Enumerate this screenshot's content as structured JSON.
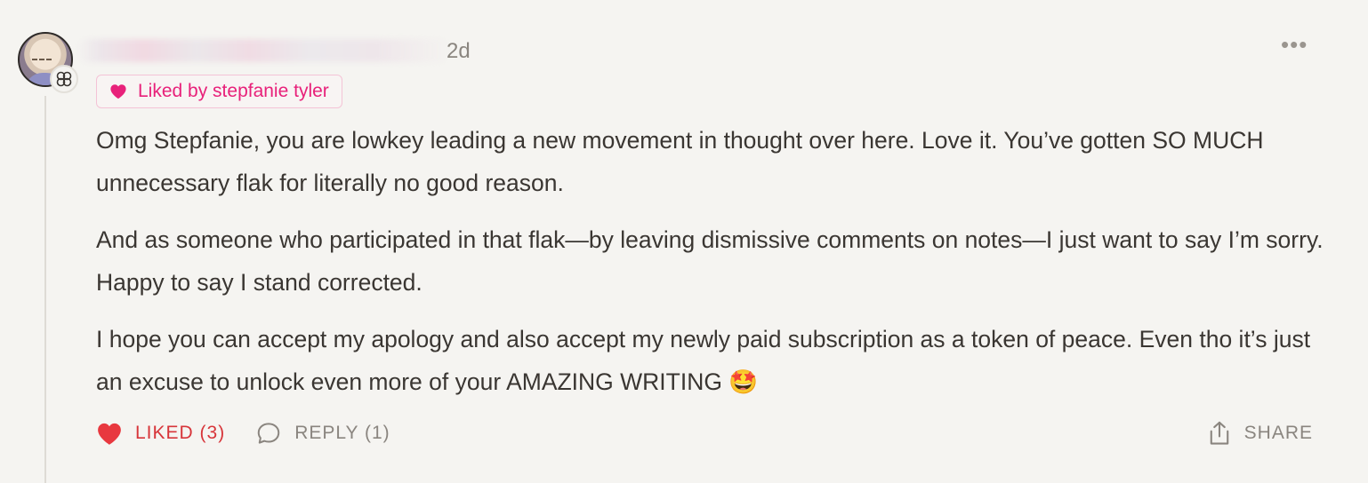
{
  "comment": {
    "timestamp": "2d",
    "more_label": "•••",
    "liked_badge": {
      "text": "Liked by stepfanie tyler",
      "icon": "heart-icon",
      "color": "#e8217a"
    },
    "body": [
      "Omg Stepfanie, you are lowkey leading a new movement in thought over here. Love it. You’ve gotten SO MUCH unnecessary flak for literally no good reason.",
      "And as someone who participated in that flak—by leaving dismissive comments on notes—I just want to say I’m sorry. Happy to say I stand corrected.",
      "I hope you can accept my apology and also accept my newly paid subscription as a token of peace. Even tho it’s just an excuse to unlock even more of your AMAZING WRITING 🤩"
    ],
    "actions": {
      "like": {
        "label": "LIKED (3)",
        "icon": "heart-filled-icon",
        "color": "#d7353a"
      },
      "reply": {
        "label": "REPLY (1)",
        "icon": "speech-bubble-icon"
      },
      "share": {
        "label": "SHARE",
        "icon": "share-arrow-icon"
      }
    },
    "avatar_badge_icon": "community-badge-icon"
  }
}
